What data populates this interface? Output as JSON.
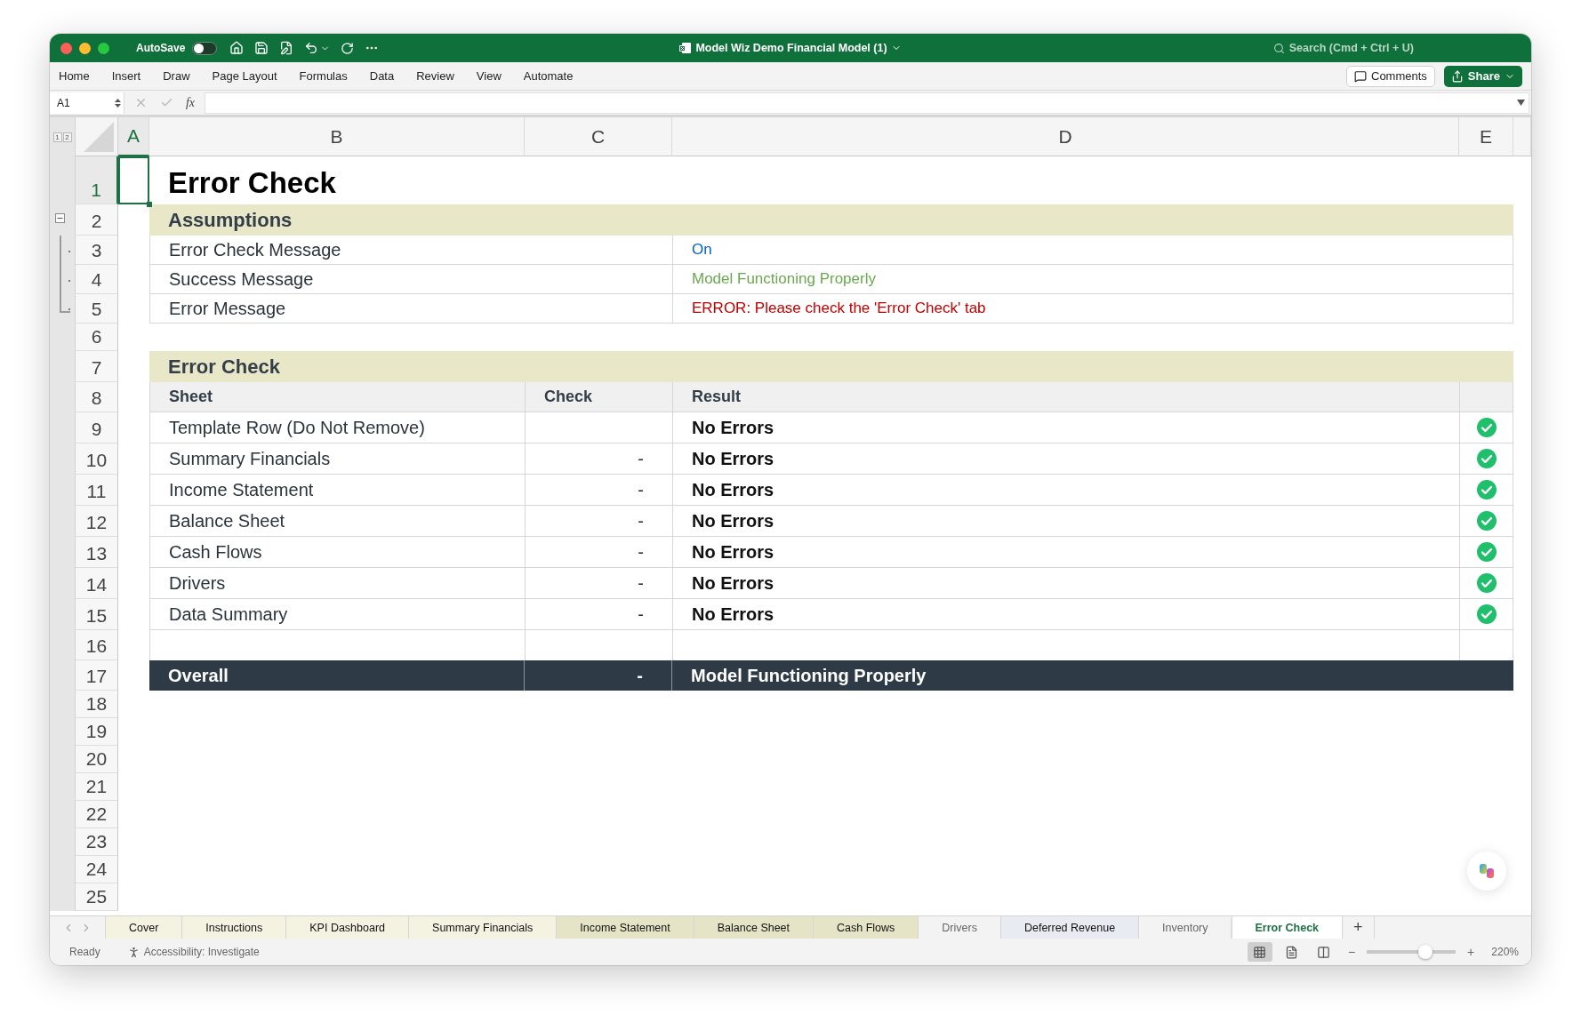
{
  "window": {
    "title": "Model Wiz Demo Financial Model (1)",
    "autosave": {
      "label": "AutoSave",
      "on": false
    },
    "search": {
      "placeholder": "Search (Cmd + Ctrl + U)"
    }
  },
  "ribbon_tabs": [
    "Home",
    "Insert",
    "Draw",
    "Page Layout",
    "Formulas",
    "Data",
    "Review",
    "View",
    "Automate"
  ],
  "ribbon_buttons": {
    "comments": "Comments",
    "share": "Share"
  },
  "formula_bar": {
    "name_box": "A1",
    "function_label": "fx"
  },
  "outline_levels": [
    "1",
    "2"
  ],
  "column_headers": [
    {
      "label": "A",
      "selected": true
    },
    {
      "label": "B",
      "selected": false
    },
    {
      "label": "C",
      "selected": false
    },
    {
      "label": "D",
      "selected": false
    },
    {
      "label": "E",
      "selected": false
    }
  ],
  "rows": [
    {
      "number": "1",
      "selected": true,
      "kind": "title",
      "text": "Error Check"
    },
    {
      "number": "2",
      "selected": false,
      "kind": "section",
      "text": "Assumptions",
      "expanded": true
    },
    {
      "number": "3",
      "selected": false,
      "kind": "assumption",
      "label": "Error Check Message",
      "value": "On",
      "color": "#0563c1",
      "grouped": true
    },
    {
      "number": "4",
      "selected": false,
      "kind": "assumption",
      "label": "Success Message",
      "value": "Model Functioning Properly",
      "color": "#6aa84f",
      "grouped": true
    },
    {
      "number": "5",
      "selected": false,
      "kind": "assumption",
      "label": "Error Message",
      "value": "ERROR: Please check the 'Error Check' tab",
      "color": "#c00000",
      "grouped": true
    },
    {
      "number": "6",
      "selected": false,
      "kind": "blank"
    },
    {
      "number": "7",
      "selected": false,
      "kind": "section",
      "text": "Error Check"
    },
    {
      "number": "8",
      "selected": false,
      "kind": "header",
      "cells": [
        "Sheet",
        "Check",
        "Result"
      ]
    },
    {
      "number": "9",
      "selected": false,
      "kind": "check",
      "sheet": "Template Row (Do Not Remove)",
      "result": "No Errors",
      "passed": true
    },
    {
      "number": "10",
      "selected": false,
      "kind": "check",
      "sheet": "Summary Financials",
      "check": "-",
      "result": "No Errors",
      "passed": true
    },
    {
      "number": "11",
      "selected": false,
      "kind": "check",
      "sheet": "Income Statement",
      "check": "-",
      "result": "No Errors",
      "passed": true
    },
    {
      "number": "12",
      "selected": false,
      "kind": "check",
      "sheet": "Balance Sheet",
      "check": "-",
      "result": "No Errors",
      "passed": true
    },
    {
      "number": "13",
      "selected": false,
      "kind": "check",
      "sheet": "Cash Flows",
      "check": "-",
      "result": "No Errors",
      "passed": true
    },
    {
      "number": "14",
      "selected": false,
      "kind": "check",
      "sheet": "Drivers",
      "check": "-",
      "result": "No Errors",
      "passed": true
    },
    {
      "number": "15",
      "selected": false,
      "kind": "check",
      "sheet": "Data Summary",
      "check": "-",
      "result": "No Errors",
      "passed": true
    },
    {
      "number": "16",
      "selected": false,
      "kind": "spacer"
    },
    {
      "number": "17",
      "selected": false,
      "kind": "overall",
      "label": "Overall",
      "check": "-",
      "result": "Model Functioning Properly"
    },
    {
      "number": "18",
      "selected": false,
      "kind": "blank"
    },
    {
      "number": "19",
      "selected": false,
      "kind": "blank"
    },
    {
      "number": "20",
      "selected": false,
      "kind": "blank"
    },
    {
      "number": "21",
      "selected": false,
      "kind": "blank"
    },
    {
      "number": "22",
      "selected": false,
      "kind": "blank"
    },
    {
      "number": "23",
      "selected": false,
      "kind": "blank"
    },
    {
      "number": "24",
      "selected": false,
      "kind": "blank"
    },
    {
      "number": "25",
      "selected": false,
      "kind": "blank"
    }
  ],
  "sheet_tabs": [
    {
      "label": "Cover",
      "selected": false,
      "color": "#f4f2e1"
    },
    {
      "label": "Instructions",
      "selected": false,
      "color": "#f4f2e1"
    },
    {
      "label": "KPI Dashboard",
      "selected": false,
      "color": "#f4f2e1"
    },
    {
      "label": "Summary Financials",
      "selected": false,
      "color": "#f4f2e1"
    },
    {
      "label": "Income Statement",
      "selected": false,
      "color": "#e6e4c6"
    },
    {
      "label": "Balance Sheet",
      "selected": false,
      "color": "#e6e4c6"
    },
    {
      "label": "Cash Flows",
      "selected": false,
      "color": "#e6e4c6"
    },
    {
      "label": "Drivers",
      "selected": false
    },
    {
      "label": "Deferred Revenue",
      "selected": false,
      "color": "#e8ebf1"
    },
    {
      "label": "Inventory",
      "selected": false
    },
    {
      "label": "Error Check",
      "selected": true
    }
  ],
  "add_sheet": "+",
  "status_bar": {
    "status": "Ready",
    "accessibility": "Accessibility: Investigate",
    "views": [
      {
        "kind": "normal",
        "selected": true
      },
      {
        "kind": "page_layout",
        "selected": false
      },
      {
        "kind": "page_break",
        "selected": false
      }
    ],
    "zoom": {
      "minus": "−",
      "plus": "+",
      "level": 0.66,
      "reading": "220%"
    }
  }
}
